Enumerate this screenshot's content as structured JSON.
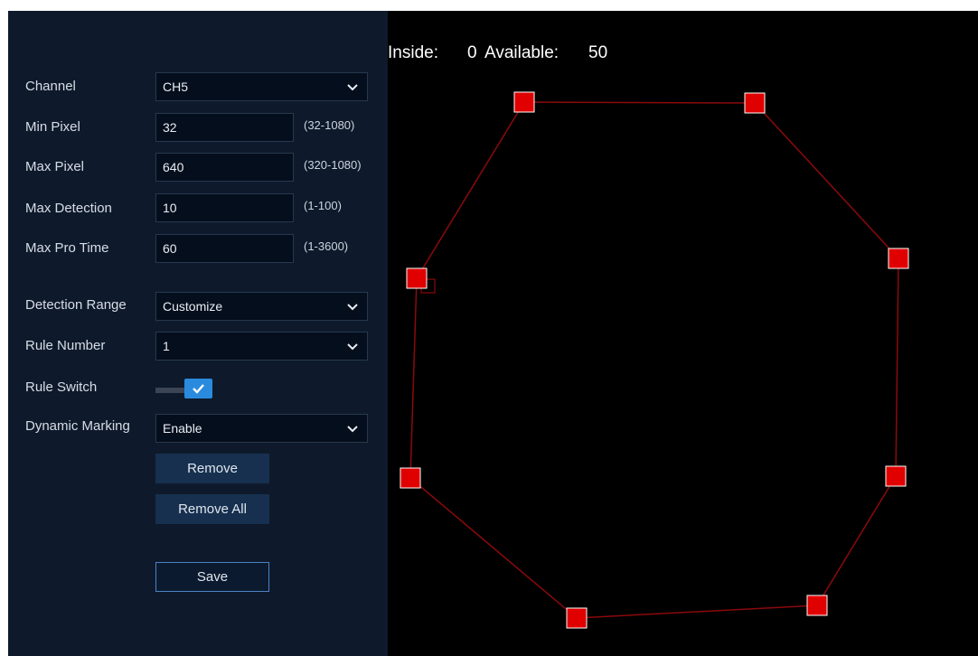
{
  "settings": {
    "channel": {
      "label": "Channel",
      "value": "CH5"
    },
    "min_pixel": {
      "label": "Min Pixel",
      "value": "32",
      "range": "(32-1080)"
    },
    "max_pixel": {
      "label": "Max Pixel",
      "value": "640",
      "range": "(320-1080)"
    },
    "max_detection": {
      "label": "Max Detection",
      "value": "10",
      "range": "(1-100)"
    },
    "max_pro_time": {
      "label": "Max Pro Time",
      "value": "60",
      "range": "(1-3600)"
    },
    "detection_range": {
      "label": "Detection Range",
      "value": "Customize"
    },
    "rule_number": {
      "label": "Rule Number",
      "value": "1"
    },
    "rule_switch": {
      "label": "Rule Switch",
      "enabled": true
    },
    "dynamic_marking": {
      "label": "Dynamic Marking",
      "value": "Enable"
    }
  },
  "buttons": {
    "remove": "Remove",
    "remove_all": "Remove All",
    "save": "Save"
  },
  "status": {
    "inside_label": "Inside:",
    "inside_value": "0",
    "available_label": "Available:",
    "available_value": "50"
  },
  "zone": {
    "color": "#e00000",
    "line_color": "#8b0a0a",
    "vertex_count": 8
  },
  "colors": {
    "panel": "#0e1a2b",
    "accent": "#2a8bde"
  }
}
